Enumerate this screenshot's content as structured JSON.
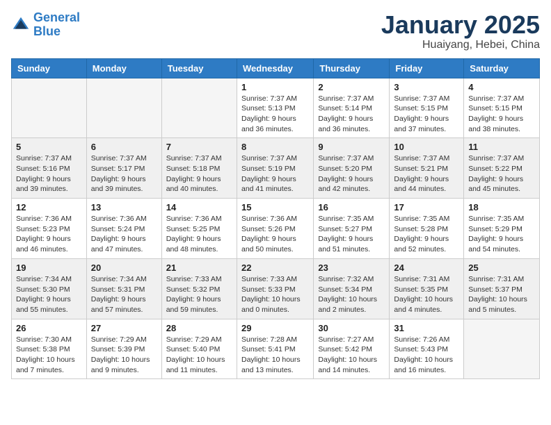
{
  "logo": {
    "line1": "General",
    "line2": "Blue"
  },
  "title": "January 2025",
  "location": "Huaiyang, Hebei, China",
  "weekdays": [
    "Sunday",
    "Monday",
    "Tuesday",
    "Wednesday",
    "Thursday",
    "Friday",
    "Saturday"
  ],
  "weeks": [
    [
      {
        "day": "",
        "detail": ""
      },
      {
        "day": "",
        "detail": ""
      },
      {
        "day": "",
        "detail": ""
      },
      {
        "day": "1",
        "detail": "Sunrise: 7:37 AM\nSunset: 5:13 PM\nDaylight: 9 hours\nand 36 minutes."
      },
      {
        "day": "2",
        "detail": "Sunrise: 7:37 AM\nSunset: 5:14 PM\nDaylight: 9 hours\nand 36 minutes."
      },
      {
        "day": "3",
        "detail": "Sunrise: 7:37 AM\nSunset: 5:15 PM\nDaylight: 9 hours\nand 37 minutes."
      },
      {
        "day": "4",
        "detail": "Sunrise: 7:37 AM\nSunset: 5:15 PM\nDaylight: 9 hours\nand 38 minutes."
      }
    ],
    [
      {
        "day": "5",
        "detail": "Sunrise: 7:37 AM\nSunset: 5:16 PM\nDaylight: 9 hours\nand 39 minutes."
      },
      {
        "day": "6",
        "detail": "Sunrise: 7:37 AM\nSunset: 5:17 PM\nDaylight: 9 hours\nand 39 minutes."
      },
      {
        "day": "7",
        "detail": "Sunrise: 7:37 AM\nSunset: 5:18 PM\nDaylight: 9 hours\nand 40 minutes."
      },
      {
        "day": "8",
        "detail": "Sunrise: 7:37 AM\nSunset: 5:19 PM\nDaylight: 9 hours\nand 41 minutes."
      },
      {
        "day": "9",
        "detail": "Sunrise: 7:37 AM\nSunset: 5:20 PM\nDaylight: 9 hours\nand 42 minutes."
      },
      {
        "day": "10",
        "detail": "Sunrise: 7:37 AM\nSunset: 5:21 PM\nDaylight: 9 hours\nand 44 minutes."
      },
      {
        "day": "11",
        "detail": "Sunrise: 7:37 AM\nSunset: 5:22 PM\nDaylight: 9 hours\nand 45 minutes."
      }
    ],
    [
      {
        "day": "12",
        "detail": "Sunrise: 7:36 AM\nSunset: 5:23 PM\nDaylight: 9 hours\nand 46 minutes."
      },
      {
        "day": "13",
        "detail": "Sunrise: 7:36 AM\nSunset: 5:24 PM\nDaylight: 9 hours\nand 47 minutes."
      },
      {
        "day": "14",
        "detail": "Sunrise: 7:36 AM\nSunset: 5:25 PM\nDaylight: 9 hours\nand 48 minutes."
      },
      {
        "day": "15",
        "detail": "Sunrise: 7:36 AM\nSunset: 5:26 PM\nDaylight: 9 hours\nand 50 minutes."
      },
      {
        "day": "16",
        "detail": "Sunrise: 7:35 AM\nSunset: 5:27 PM\nDaylight: 9 hours\nand 51 minutes."
      },
      {
        "day": "17",
        "detail": "Sunrise: 7:35 AM\nSunset: 5:28 PM\nDaylight: 9 hours\nand 52 minutes."
      },
      {
        "day": "18",
        "detail": "Sunrise: 7:35 AM\nSunset: 5:29 PM\nDaylight: 9 hours\nand 54 minutes."
      }
    ],
    [
      {
        "day": "19",
        "detail": "Sunrise: 7:34 AM\nSunset: 5:30 PM\nDaylight: 9 hours\nand 55 minutes."
      },
      {
        "day": "20",
        "detail": "Sunrise: 7:34 AM\nSunset: 5:31 PM\nDaylight: 9 hours\nand 57 minutes."
      },
      {
        "day": "21",
        "detail": "Sunrise: 7:33 AM\nSunset: 5:32 PM\nDaylight: 9 hours\nand 59 minutes."
      },
      {
        "day": "22",
        "detail": "Sunrise: 7:33 AM\nSunset: 5:33 PM\nDaylight: 10 hours\nand 0 minutes."
      },
      {
        "day": "23",
        "detail": "Sunrise: 7:32 AM\nSunset: 5:34 PM\nDaylight: 10 hours\nand 2 minutes."
      },
      {
        "day": "24",
        "detail": "Sunrise: 7:31 AM\nSunset: 5:35 PM\nDaylight: 10 hours\nand 4 minutes."
      },
      {
        "day": "25",
        "detail": "Sunrise: 7:31 AM\nSunset: 5:37 PM\nDaylight: 10 hours\nand 5 minutes."
      }
    ],
    [
      {
        "day": "26",
        "detail": "Sunrise: 7:30 AM\nSunset: 5:38 PM\nDaylight: 10 hours\nand 7 minutes."
      },
      {
        "day": "27",
        "detail": "Sunrise: 7:29 AM\nSunset: 5:39 PM\nDaylight: 10 hours\nand 9 minutes."
      },
      {
        "day": "28",
        "detail": "Sunrise: 7:29 AM\nSunset: 5:40 PM\nDaylight: 10 hours\nand 11 minutes."
      },
      {
        "day": "29",
        "detail": "Sunrise: 7:28 AM\nSunset: 5:41 PM\nDaylight: 10 hours\nand 13 minutes."
      },
      {
        "day": "30",
        "detail": "Sunrise: 7:27 AM\nSunset: 5:42 PM\nDaylight: 10 hours\nand 14 minutes."
      },
      {
        "day": "31",
        "detail": "Sunrise: 7:26 AM\nSunset: 5:43 PM\nDaylight: 10 hours\nand 16 minutes."
      },
      {
        "day": "",
        "detail": ""
      }
    ]
  ]
}
